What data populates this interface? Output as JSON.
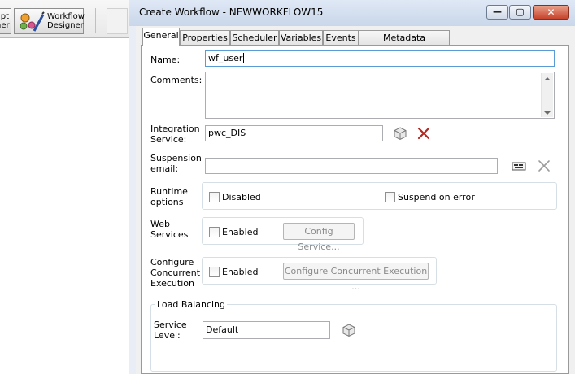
{
  "background_app": {
    "toolbar": {
      "partial_button_text": [
        "pt",
        "ner"
      ],
      "workflow_designer_lines": [
        "Workflow",
        "Designer"
      ]
    }
  },
  "dialog": {
    "title": "Create Workflow - NEWWORKFLOW15",
    "window_buttons": {
      "minimize": "—",
      "maximize": "▢",
      "close": "✕"
    },
    "tabs": [
      {
        "label": "General",
        "active": true
      },
      {
        "label": "Properties"
      },
      {
        "label": "Scheduler"
      },
      {
        "label": "Variables"
      },
      {
        "label": "Events"
      },
      {
        "label": "Metadata Extensions"
      }
    ],
    "general": {
      "name_label": "Name:",
      "name_value": "wf_user",
      "comments_label": "Comments:",
      "comments_value": "",
      "integration_label_1": "Integration",
      "integration_label_2": "Service:",
      "integration_value": "pwc_DIS",
      "suspension_label_1": "Suspension",
      "suspension_label_2": "email:",
      "suspension_value": "",
      "runtime_label_1": "Runtime",
      "runtime_label_2": "options",
      "disabled_label": "Disabled",
      "suspend_on_error_label": "Suspend on error",
      "web_label_1": "Web",
      "web_label_2": "Services",
      "web_enabled_label": "Enabled",
      "config_service_button": "Config Service...",
      "concurrent_label_1": "Configure",
      "concurrent_label_2": "Concurrent",
      "concurrent_label_3": "Execution",
      "concurrent_enabled_label": "Enabled",
      "configure_concurrent_button": "Configure Concurrent Execution ...",
      "load_balancing_label": "Load Balancing",
      "service_level_label_1": "Service",
      "service_level_label_2": "Level:",
      "service_level_value": "Default"
    }
  },
  "colors": {
    "titlebar": "#c9d7ea",
    "close_button": "#c7432b",
    "delete_red": "#c0392b"
  }
}
